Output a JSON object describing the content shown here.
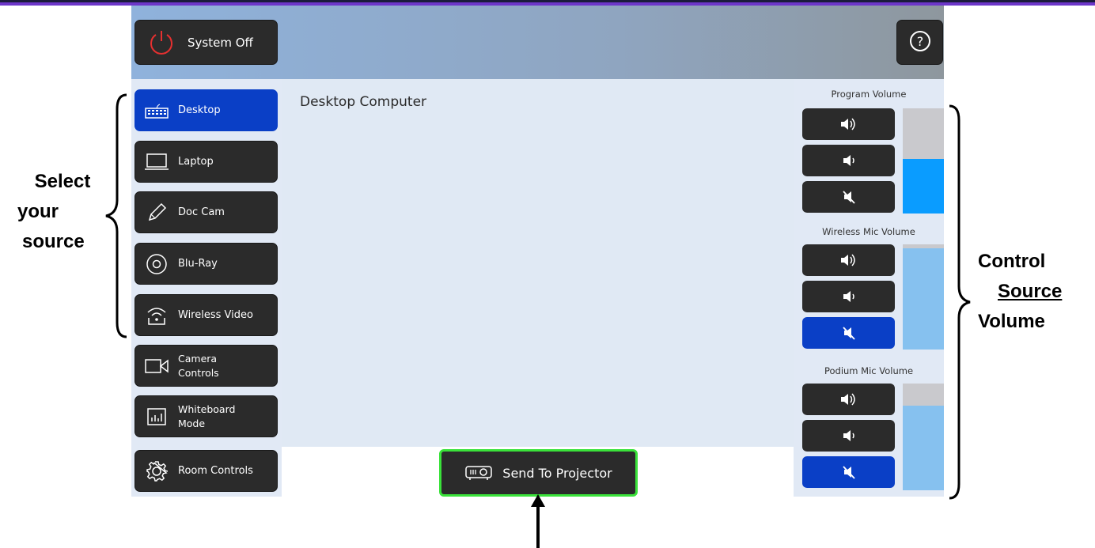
{
  "header": {
    "system_off_label": "System Off",
    "power_icon": "power-icon",
    "help_icon": "help-icon"
  },
  "sources": [
    {
      "label": "Desktop",
      "icon": "keyboard-icon",
      "active": true
    },
    {
      "label": "Laptop",
      "icon": "laptop-icon",
      "active": false
    },
    {
      "label": "Doc Cam",
      "icon": "pencil-icon",
      "active": false
    },
    {
      "label": "Blu-Ray",
      "icon": "disc-icon",
      "active": false
    },
    {
      "label": "Wireless Video",
      "icon": "wireless-icon",
      "active": false
    },
    {
      "label": "Camera\nControls",
      "icon": "camera-icon",
      "active": false
    },
    {
      "label": "Whiteboard\nMode",
      "icon": "whiteboard-icon",
      "active": false
    },
    {
      "label": "Room Controls",
      "icon": "gear-icon",
      "active": false
    }
  ],
  "content": {
    "title": "Desktop Computer"
  },
  "volume": {
    "program": {
      "title": "Program Volume",
      "level": 0.52,
      "muted": false,
      "fill_color": "#0a9cff"
    },
    "wireless": {
      "title": "Wireless Mic Volume",
      "level": 0.96,
      "muted": true,
      "fill_color": "#86c1ef"
    },
    "podium": {
      "title": "Podium Mic Volume",
      "level": 0.79,
      "muted": true,
      "fill_color": "#86c1ef"
    }
  },
  "send": {
    "label": "Send To Projector",
    "icon": "projector-icon"
  },
  "annotations": {
    "left": [
      "Select",
      "your",
      "source"
    ],
    "right_line1": "Control",
    "right_line2": "Source",
    "right_line3": "Volume"
  },
  "colors": {
    "active_blue": "#0a3fc6",
    "send_border": "#3ae23a",
    "header_purple": "#6d36c9"
  }
}
